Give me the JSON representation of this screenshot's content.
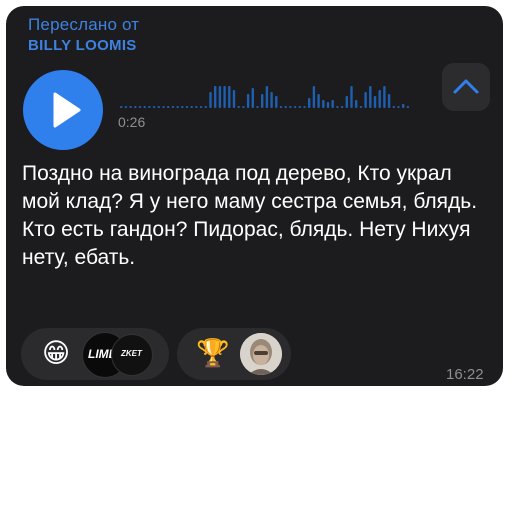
{
  "forward": {
    "label": "Переслано от",
    "name": "BILLY LOOMIS"
  },
  "voice": {
    "duration": "0:26",
    "played_fraction": 0.0
  },
  "message": {
    "text": "Поздно на винограда под дерево, Кто украл мой клад? Я у него маму сестра семья, блядь. Кто есть гандон? Пидорас, блядь. Нету Нихуя нету, ебать.",
    "time": "16:22"
  },
  "reactions": [
    {
      "emoji": "😁",
      "avatars": [
        "LIMB",
        "ZKET"
      ]
    },
    {
      "emoji": "🏆",
      "avatars": [
        "person-photo"
      ]
    }
  ],
  "colors": {
    "accent": "#2f80ed",
    "bubble": "#1c1c1e",
    "secondary_text": "#8e8e93"
  },
  "icons": [
    "play-icon",
    "chevron-up-icon"
  ]
}
